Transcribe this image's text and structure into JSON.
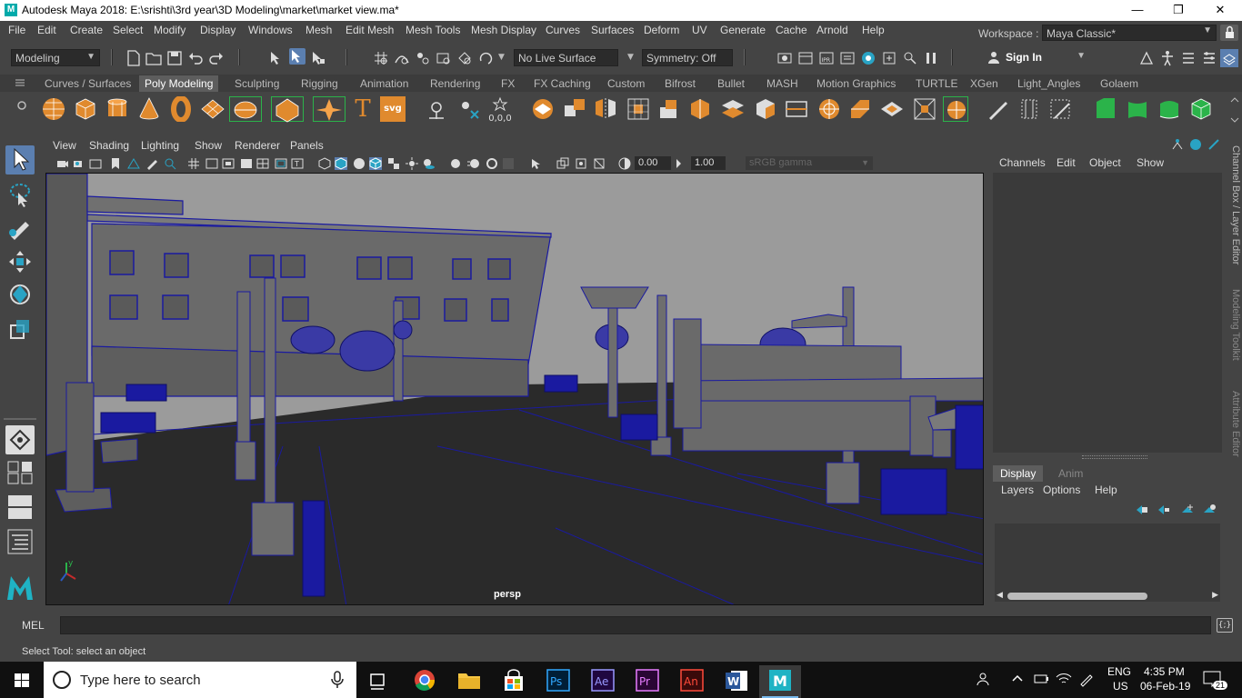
{
  "window": {
    "title": "Autodesk Maya 2018: E:\\srishti\\3rd year\\3D Modeling\\market\\market view.ma*",
    "app_icon_letter": "M"
  },
  "menubar": {
    "items": [
      "File",
      "Edit",
      "Create",
      "Select",
      "Modify",
      "Display",
      "Windows",
      "Mesh",
      "Edit Mesh",
      "Mesh Tools",
      "Mesh Display",
      "Curves",
      "Surfaces",
      "Deform",
      "UV",
      "Generate",
      "Cache",
      "Arnold",
      "Help"
    ],
    "workspace_label": "Workspace :",
    "workspace_value": "Maya Classic*"
  },
  "statusline": {
    "mode": "Modeling",
    "live_surface": "No Live Surface",
    "symmetry": "Symmetry: Off",
    "sign_in": "Sign In"
  },
  "shelf": {
    "tabs": [
      "Curves / Surfaces",
      "Poly Modeling",
      "Sculpting",
      "Rigging",
      "Animation",
      "Rendering",
      "FX",
      "FX Caching",
      "Custom",
      "Bifrost",
      "Bullet",
      "MASH",
      "Motion Graphics",
      "TURTLE",
      "XGen",
      "Light_Angles",
      "Golaem"
    ],
    "active_tab": "Poly Modeling",
    "text_icon": "T",
    "svg_icon": "svg",
    "coords_icon": "0,0,0"
  },
  "panel": {
    "menus": [
      "View",
      "Shading",
      "Lighting",
      "Show",
      "Renderer",
      "Panels"
    ],
    "exposure": "0.00",
    "gamma": "1.00",
    "color_space": "sRGB gamma",
    "camera_label": "persp",
    "axis_y": "y"
  },
  "channel_box": {
    "menus": [
      "Channels",
      "Edit",
      "Object",
      "Show"
    ]
  },
  "layer_editor": {
    "tabs": [
      "Display",
      "Anim"
    ],
    "active_tab": "Display",
    "menus": [
      "Layers",
      "Options",
      "Help"
    ]
  },
  "side_tabs": [
    "Channel Box / Layer Editor",
    "Modeling Toolkit",
    "Attribute Editor"
  ],
  "command_line": {
    "label": "MEL"
  },
  "help_line": {
    "text": "Select Tool: select an object"
  },
  "taskbar": {
    "search_placeholder": "Type here to search",
    "apps": [
      "Ps",
      "Ae",
      "Pr",
      "An",
      "W",
      "M"
    ],
    "language": "ENG",
    "region": "US",
    "time": "4:35 PM",
    "date": "06-Feb-19",
    "notification_count": "21"
  },
  "colors": {
    "ui_bg": "#444444",
    "field_bg": "#2b2b2b",
    "active_tab": "#5d5d5d",
    "wireframe": "#1a1aa0",
    "sky": "#9b9b9b",
    "ground": "#2a2a2a",
    "maya_teal": "#1fb3c4"
  }
}
